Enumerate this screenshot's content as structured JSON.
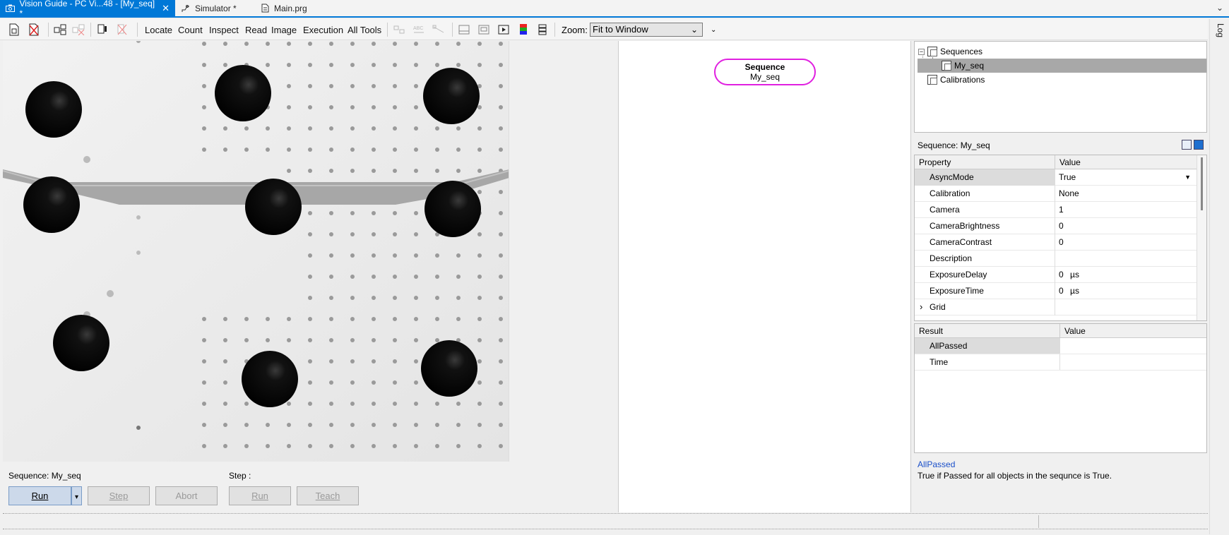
{
  "tabs": [
    {
      "label": "Vision Guide - PC Vi...48 - [My_seq] *",
      "icon": "camera-icon",
      "close": "✕",
      "active": true
    },
    {
      "label": "Simulator *",
      "icon": "robot-icon",
      "active": false
    },
    {
      "label": "Main.prg",
      "icon": "document-icon",
      "active": false
    }
  ],
  "toolbar": {
    "menus": [
      "Locate",
      "Count",
      "Inspect",
      "Read",
      "Image",
      "Execution",
      "All Tools"
    ],
    "zoom_label": "Zoom:",
    "zoom_value": "Fit to Window"
  },
  "log_tab": "Log",
  "flowchart": {
    "node_title": "Sequence",
    "node_name": "My_seq"
  },
  "controls": {
    "sequence_label": "Sequence: My_seq",
    "step_label": "Step :",
    "run_label": "Run",
    "step_button": "Step",
    "abort_button": "Abort",
    "step_run_button": "Run",
    "teach_button": "Teach"
  },
  "tree": {
    "sequences": "Sequences",
    "my_seq": "My_seq",
    "calibrations": "Calibrations"
  },
  "properties": {
    "header": "Sequence: My_seq",
    "col_property": "Property",
    "col_value": "Value",
    "rows": [
      {
        "name": "AsyncMode",
        "value": "True",
        "dropdown": "▼"
      },
      {
        "name": "Calibration",
        "value": "None"
      },
      {
        "name": "Camera",
        "value": "1"
      },
      {
        "name": "CameraBrightness",
        "value": "0"
      },
      {
        "name": "CameraContrast",
        "value": "0"
      },
      {
        "name": "Description",
        "value": ""
      },
      {
        "name": "ExposureDelay",
        "value": "0",
        "unit": "µs"
      },
      {
        "name": "ExposureTime",
        "value": "0",
        "unit": "µs"
      },
      {
        "name": "Grid",
        "value": "",
        "expander": "›"
      }
    ]
  },
  "results": {
    "col_result": "Result",
    "col_value": "Value",
    "rows": [
      {
        "name": "AllPassed",
        "value": ""
      },
      {
        "name": "Time",
        "value": ""
      }
    ]
  },
  "description": {
    "title": "AllPassed",
    "text": "True if Passed for all objects in the sequnce is True."
  },
  "colors": {
    "accent": "#0078d7",
    "node_border": "#e020e0",
    "selection": "#a8a8a8"
  }
}
